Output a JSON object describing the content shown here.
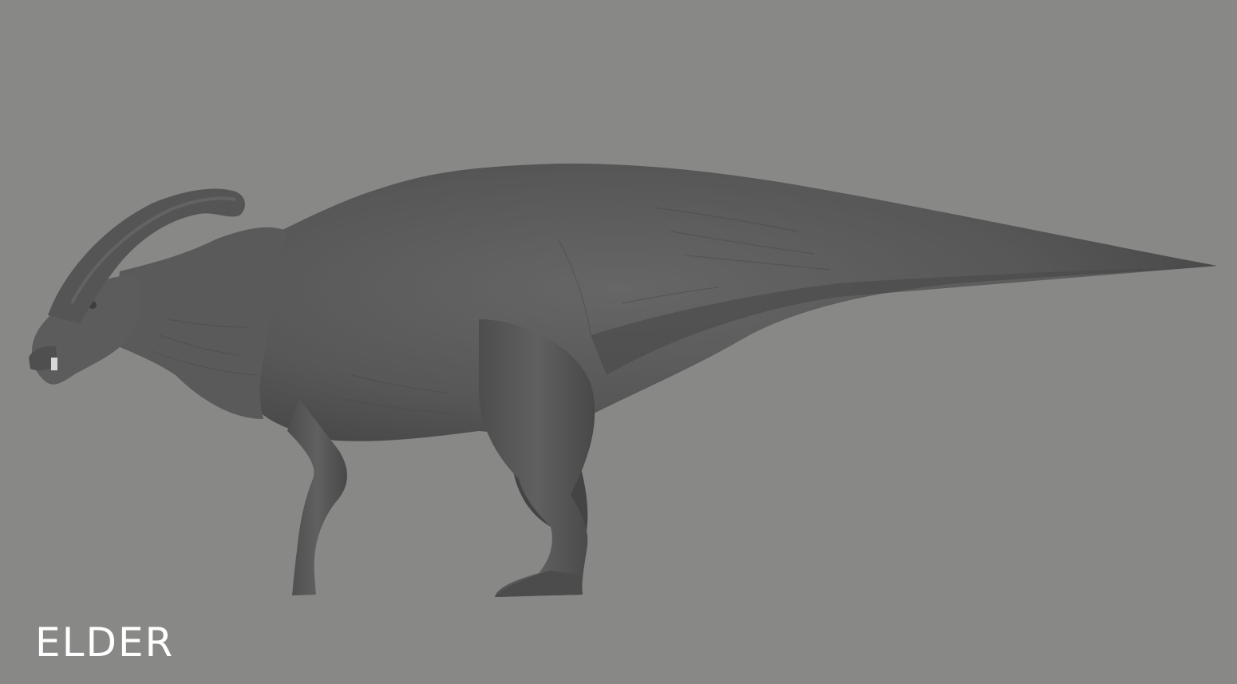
{
  "caption": "ELDER",
  "subject": "parasaurolophus-sculpt",
  "colors": {
    "background": "#888887",
    "body": "#565656",
    "caption": "#ffffff"
  }
}
